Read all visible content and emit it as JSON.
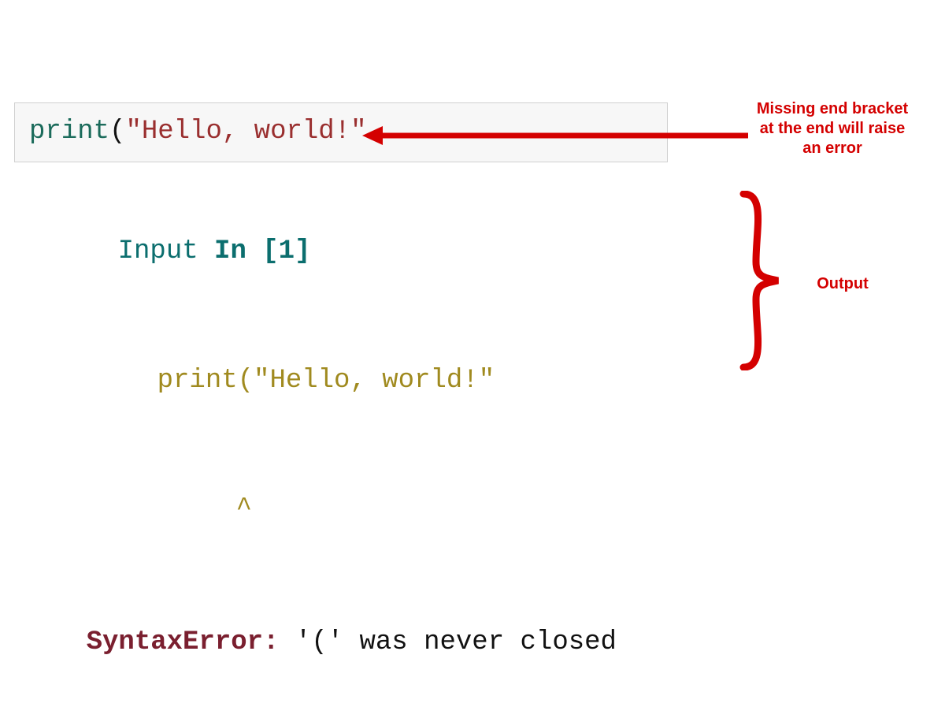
{
  "code_cell": {
    "print_token": "print",
    "open_paren": "(",
    "string_literal": "\"Hello, world!\""
  },
  "output": {
    "line1_input": "Input ",
    "line1_in": "In ",
    "line1_brackets": "[1]",
    "line2_code": "print(\"Hello, world!\"",
    "line3_caret": "^",
    "line4_error_label": "SyntaxError:",
    "line4_error_msg": " '(' was never closed"
  },
  "annotations": {
    "top_note": "Missing end bracket at the end will raise an error",
    "right_note": "Output"
  },
  "colors": {
    "annotation_red": "#d40000",
    "teal": "#0b6e6e",
    "olive": "#a08a1f",
    "maroon": "#7a1f2f"
  }
}
